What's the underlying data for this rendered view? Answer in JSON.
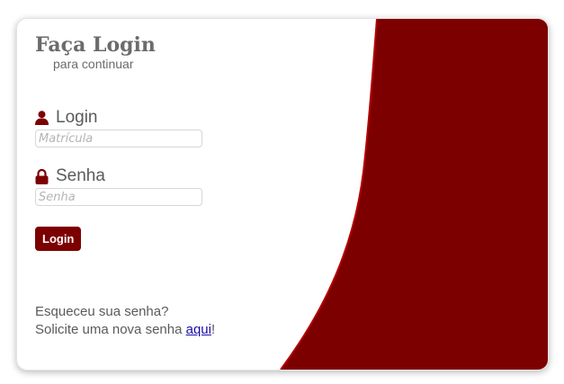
{
  "header": {
    "title": "Faça Login",
    "subtitle": "para continuar"
  },
  "form": {
    "login_label": "Login",
    "login_placeholder": "Matrícula",
    "login_value": "",
    "senha_label": "Senha",
    "senha_placeholder": "Senha",
    "senha_value": "",
    "submit_label": "Login"
  },
  "forgot": {
    "line1": "Esqueceu sua senha?",
    "line2_prefix": "Solicite uma nova senha ",
    "link_text": "aqui",
    "line2_suffix": "!"
  },
  "icons": {
    "login": "user-icon",
    "senha": "lock-icon"
  },
  "colors": {
    "accent": "#7d0000",
    "text": "#6b6b6b",
    "link": "#1a0dab"
  }
}
